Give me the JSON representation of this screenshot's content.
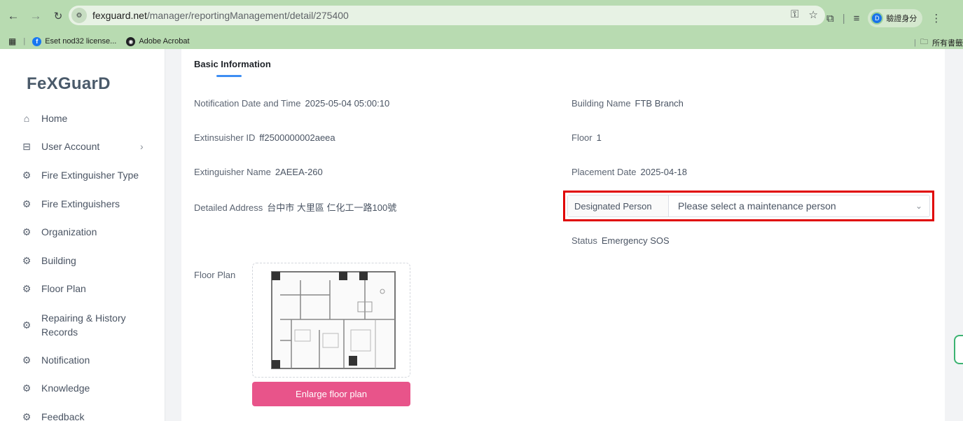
{
  "browser": {
    "url_host": "fexguard.net",
    "url_path": "/manager/reportingManagement/detail/275400",
    "profile_label": "驗證身分",
    "bookmarks": [
      {
        "label": "Eset nod32 license..."
      },
      {
        "label": "Adobe Acrobat"
      }
    ],
    "all_bookmarks_label": "所有書籤"
  },
  "sidebar": {
    "logo": "FeXGuarD",
    "items": [
      {
        "label": "Home",
        "icon": "home-icon"
      },
      {
        "label": "User Account",
        "icon": "table-icon"
      },
      {
        "label": "Fire Extinguisher Type",
        "icon": "gear-icon"
      },
      {
        "label": "Fire Extinguishers",
        "icon": "gear-icon"
      },
      {
        "label": "Organization",
        "icon": "gear-icon"
      },
      {
        "label": "Building",
        "icon": "gear-icon"
      },
      {
        "label": "Floor Plan",
        "icon": "gear-icon"
      },
      {
        "label": "Repairing & History",
        "label2": "Records",
        "icon": "gear-icon"
      },
      {
        "label": "Notification",
        "icon": "gear-icon"
      },
      {
        "label": "Knowledge",
        "icon": "gear-icon"
      },
      {
        "label": "Feedback",
        "icon": "gear-icon"
      }
    ]
  },
  "main": {
    "tab_title": "Basic Information",
    "fields": {
      "notification_datetime": {
        "label": "Notification Date and Time",
        "value": "2025-05-04 05:00:10"
      },
      "extinguisher_id": {
        "label": "Extinsuisher ID",
        "value": "ff2500000002aeea"
      },
      "extinguisher_name": {
        "label": "Extinguisher Name",
        "value": "2AEEA-260"
      },
      "detailed_address": {
        "label": "Detailed Address",
        "value": "台中市 大里區 仁化工一路100號"
      },
      "building_name": {
        "label": "Building Name",
        "value": "FTB Branch"
      },
      "floor": {
        "label": "Floor",
        "value": "1"
      },
      "placement_date": {
        "label": "Placement Date",
        "value": "2025-04-18"
      },
      "status": {
        "label": "Status",
        "value": "Emergency SOS"
      }
    },
    "designated_person": {
      "label": "Designated Person",
      "placeholder": "Please select a maintenance person"
    },
    "floor_plan_label": "Floor Plan",
    "enlarge_button": "Enlarge floor plan"
  },
  "colors": {
    "accent": "#3d8ef3",
    "button": "#e8548a",
    "highlight_border": "#e00000",
    "browser_frame": "#b8dbb1"
  }
}
